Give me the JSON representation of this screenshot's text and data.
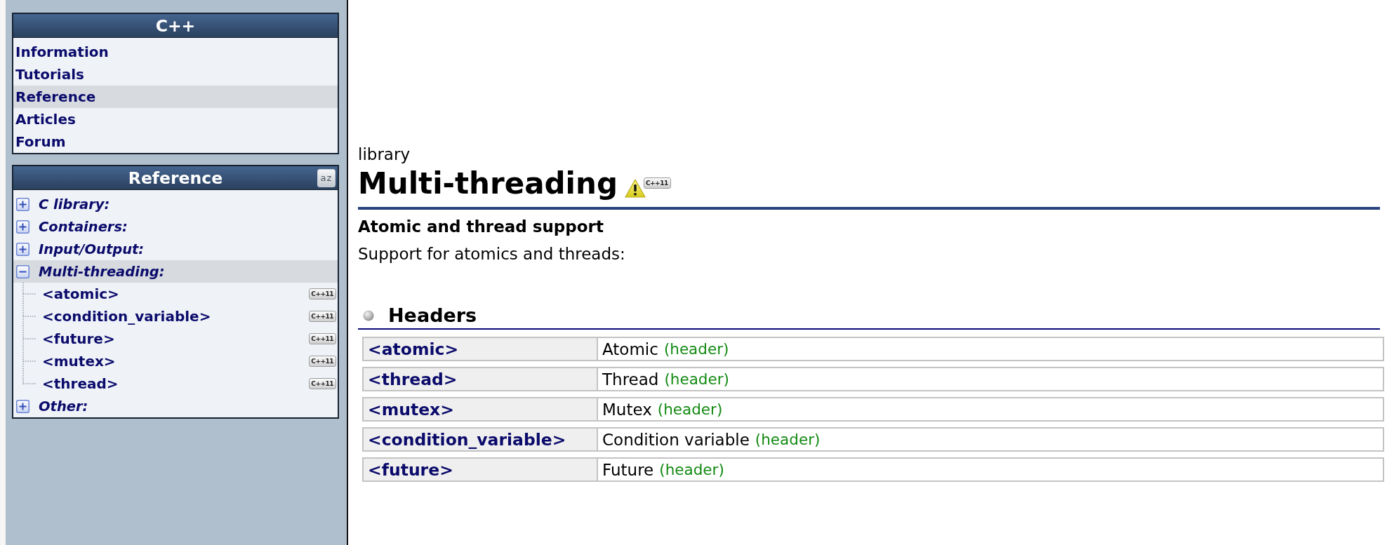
{
  "sidebar": {
    "panels": [
      {
        "kind": "menu",
        "title": "C++",
        "items": [
          {
            "label": "Information",
            "selected": false
          },
          {
            "label": "Tutorials",
            "selected": false
          },
          {
            "label": "Reference",
            "selected": true
          },
          {
            "label": "Articles",
            "selected": false
          },
          {
            "label": "Forum",
            "selected": false
          }
        ]
      },
      {
        "kind": "tree",
        "title": "Reference",
        "sort_button": "az",
        "items": [
          {
            "label": "C library:",
            "expanded": false,
            "selected": false
          },
          {
            "label": "Containers:",
            "expanded": false,
            "selected": false
          },
          {
            "label": "Input/Output:",
            "expanded": false,
            "selected": false
          },
          {
            "label": "Multi-threading:",
            "expanded": true,
            "selected": true,
            "children": [
              {
                "label": "<atomic>",
                "badge": "C++11",
                "selected": false
              },
              {
                "label": "<condition_variable>",
                "badge": "C++11",
                "selected": false
              },
              {
                "label": "<future>",
                "badge": "C++11",
                "selected": false
              },
              {
                "label": "<mutex>",
                "badge": "C++11",
                "selected": false
              },
              {
                "label": "<thread>",
                "badge": "C++11",
                "selected": false
              }
            ]
          },
          {
            "label": "Other:",
            "expanded": false,
            "selected": false
          }
        ]
      }
    ]
  },
  "page": {
    "category": "library",
    "title": "Multi-threading",
    "title_badge": "C++11",
    "subtitle": "Atomic and thread support",
    "description": "Support for atomics and threads:",
    "sections": [
      {
        "title": "Headers",
        "rows": [
          {
            "name": "<atomic>",
            "description": "Atomic",
            "note": "(header)"
          },
          {
            "name": "<thread>",
            "description": "Thread",
            "note": "(header)"
          },
          {
            "name": "<mutex>",
            "description": "Mutex",
            "note": "(header)"
          },
          {
            "name": "<condition_variable>",
            "description": "Condition variable",
            "note": "(header)"
          },
          {
            "name": "<future>",
            "description": "Future",
            "note": "(header)"
          }
        ]
      }
    ]
  }
}
